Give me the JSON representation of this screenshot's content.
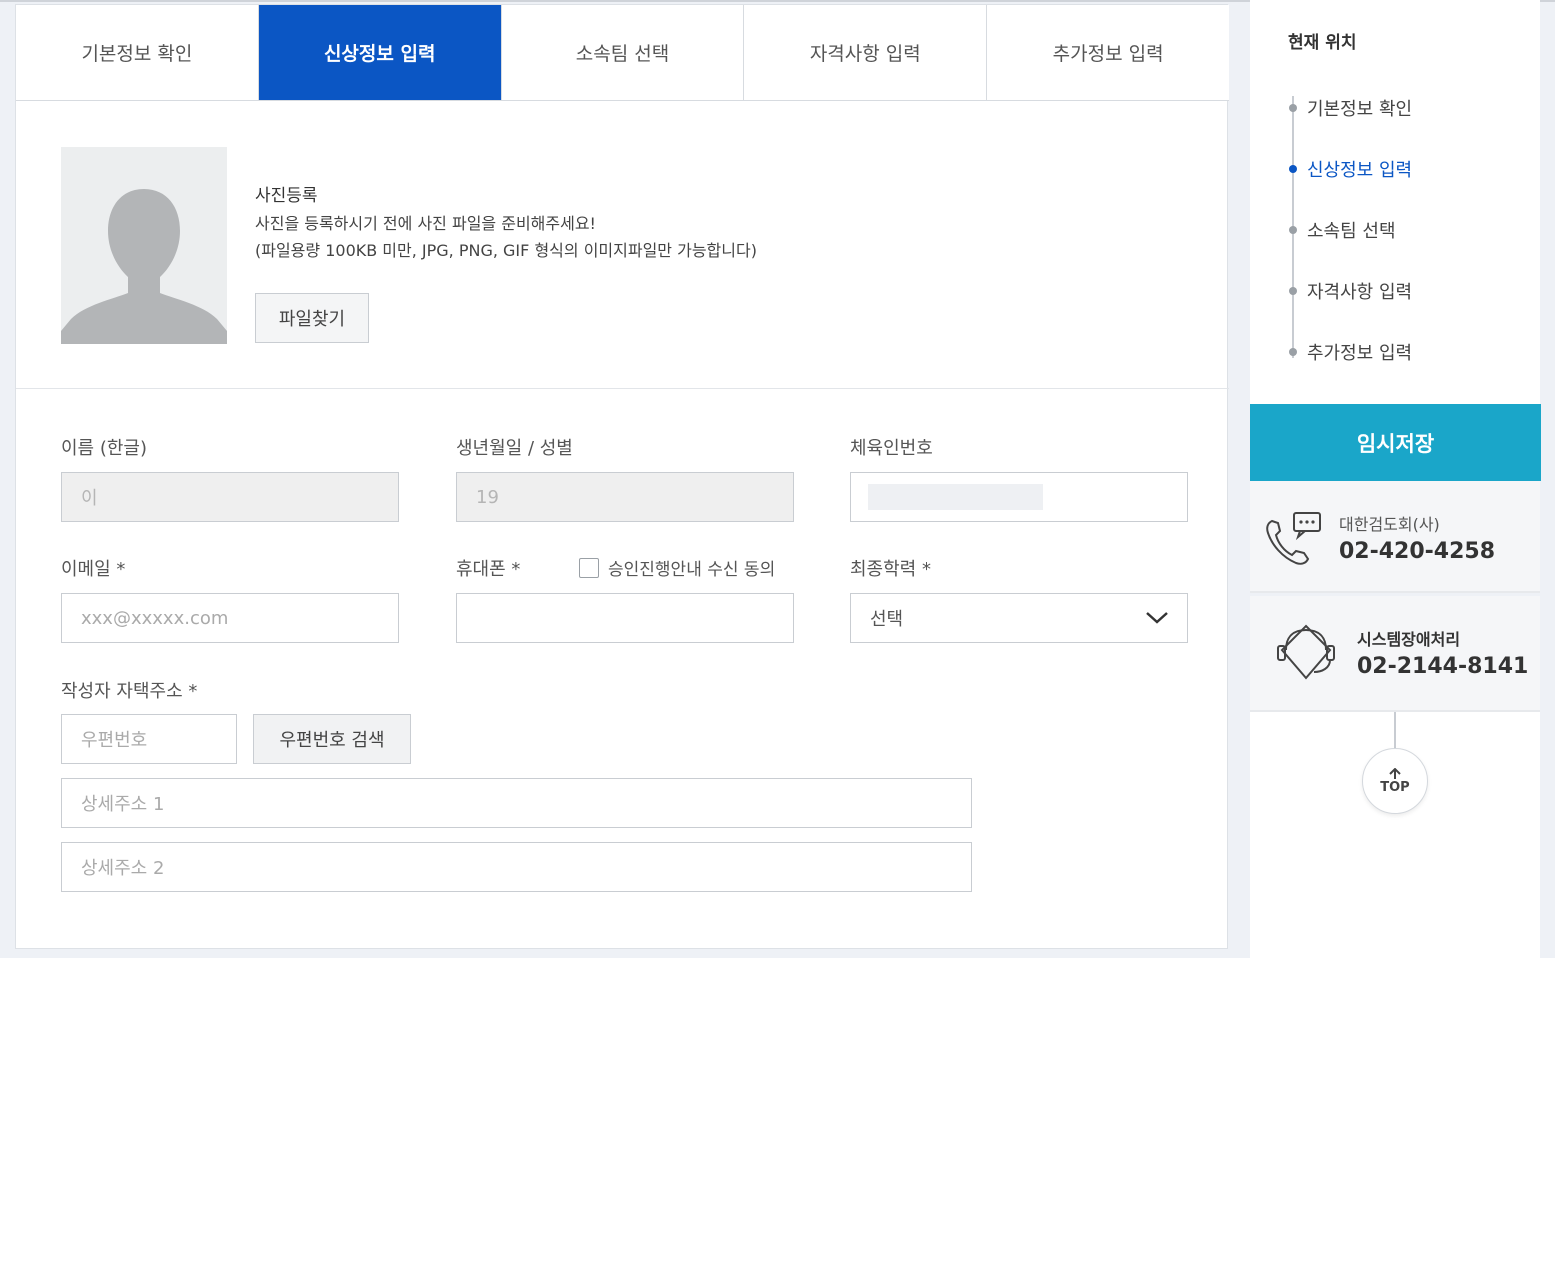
{
  "tabs": [
    {
      "label": "기본정보 확인"
    },
    {
      "label": "신상정보 입력"
    },
    {
      "label": "소속팀 선택"
    },
    {
      "label": "자격사항 입력"
    },
    {
      "label": "추가정보 입력"
    }
  ],
  "photo": {
    "title": "사진등록",
    "line1": "사진을 등록하시기 전에 사진 파일을 준비해주세요!",
    "line2": "(파일용량 100KB 미만, JPG, PNG, GIF 형식의 이미지파일만 가능합니다)",
    "file_button": "파일찾기"
  },
  "form": {
    "name_label": "이름 (한글)",
    "name_value": "이",
    "birth_label": "생년월일 / 성별",
    "birth_value": "19",
    "sport_label": "체육인번호",
    "email_label": "이메일 *",
    "email_placeholder": "xxx@xxxxx.com",
    "phone_label": "휴대폰 *",
    "consent_label": "승인진행안내 수신 동의",
    "edu_label": "최종학력 *",
    "edu_selected": "선택",
    "address_label": "작성자 자택주소 *",
    "zip_placeholder": "우편번호",
    "zip_button": "우편번호 검색",
    "addr1_placeholder": "상세주소 1",
    "addr2_placeholder": "상세주소 2"
  },
  "sidebar": {
    "title": "현재 위치",
    "nav": [
      {
        "label": "기본정보 확인"
      },
      {
        "label": "신상정보 입력"
      },
      {
        "label": "소속팀 선택"
      },
      {
        "label": "자격사항 입력"
      },
      {
        "label": "추가정보 입력"
      }
    ],
    "save_button": "임시저장",
    "contact1_name": "대한검도회(사)",
    "contact1_phone": "02-420-4258",
    "contact2_name": "시스템장애처리",
    "contact2_phone": "02-2144-8141",
    "top_button": "TOP"
  },
  "colors": {
    "primary": "#0b56c4",
    "accent": "#1aa6c9"
  }
}
